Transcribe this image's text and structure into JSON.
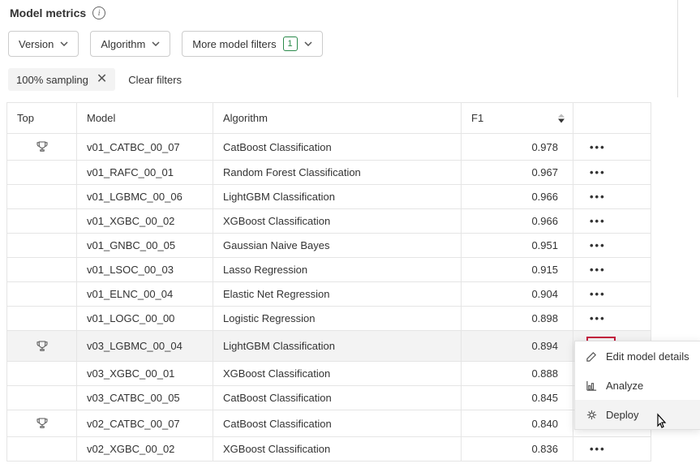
{
  "title": "Model metrics",
  "filters": {
    "version": "Version",
    "algorithm": "Algorithm",
    "more": "More model filters",
    "more_count": "1"
  },
  "chip": {
    "label": "100% sampling"
  },
  "clear_filters": "Clear filters",
  "columns": {
    "top": "Top",
    "model": "Model",
    "algorithm": "Algorithm",
    "f1": "F1"
  },
  "rows": [
    {
      "top": true,
      "model": "v01_CATBC_00_07",
      "algorithm": "CatBoost Classification",
      "f1": "0.978"
    },
    {
      "top": false,
      "model": "v01_RAFC_00_01",
      "algorithm": "Random Forest Classification",
      "f1": "0.967"
    },
    {
      "top": false,
      "model": "v01_LGBMC_00_06",
      "algorithm": "LightGBM Classification",
      "f1": "0.966"
    },
    {
      "top": false,
      "model": "v01_XGBC_00_02",
      "algorithm": "XGBoost Classification",
      "f1": "0.966"
    },
    {
      "top": false,
      "model": "v01_GNBC_00_05",
      "algorithm": "Gaussian Naive Bayes",
      "f1": "0.951"
    },
    {
      "top": false,
      "model": "v01_LSOC_00_03",
      "algorithm": "Lasso Regression",
      "f1": "0.915"
    },
    {
      "top": false,
      "model": "v01_ELNC_00_04",
      "algorithm": "Elastic Net Regression",
      "f1": "0.904"
    },
    {
      "top": false,
      "model": "v01_LOGC_00_00",
      "algorithm": "Logistic Regression",
      "f1": "0.898"
    },
    {
      "top": true,
      "model": "v03_LGBMC_00_04",
      "algorithm": "LightGBM Classification",
      "f1": "0.894",
      "highlight": true,
      "dots_boxed": true
    },
    {
      "top": false,
      "model": "v03_XGBC_00_01",
      "algorithm": "XGBoost Classification",
      "f1": "0.888"
    },
    {
      "top": false,
      "model": "v03_CATBC_00_05",
      "algorithm": "CatBoost Classification",
      "f1": "0.845"
    },
    {
      "top": true,
      "model": "v02_CATBC_00_07",
      "algorithm": "CatBoost Classification",
      "f1": "0.840"
    },
    {
      "top": false,
      "model": "v02_XGBC_00_02",
      "algorithm": "XGBoost Classification",
      "f1": "0.836"
    }
  ],
  "menu": {
    "edit": "Edit model details",
    "analyze": "Analyze",
    "deploy": "Deploy"
  }
}
